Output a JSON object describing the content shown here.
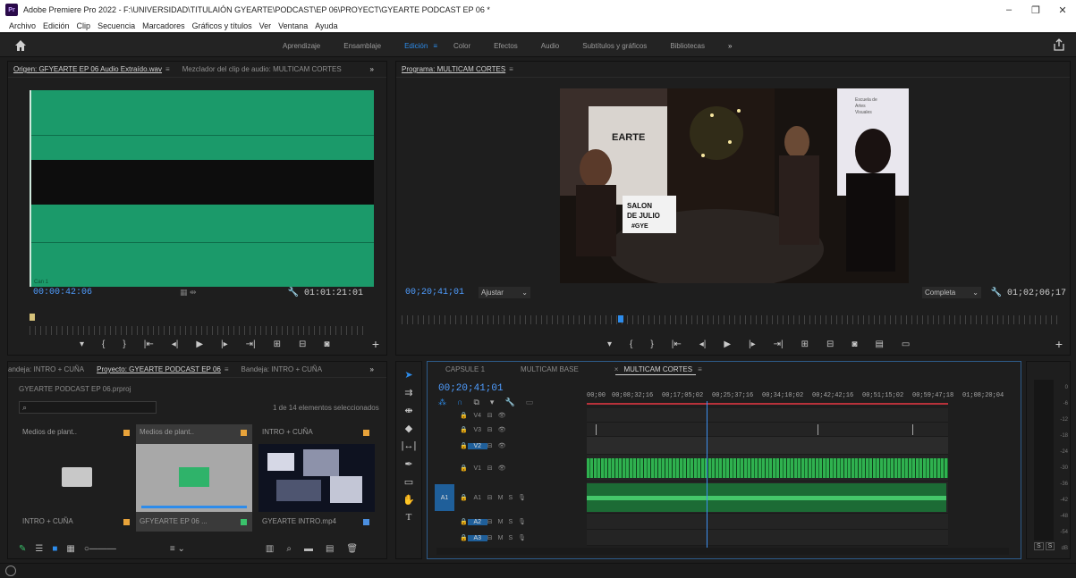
{
  "window": {
    "title": "Adobe Premiere Pro 2022 - F:\\UNIVERSIDAD\\TITULAIÓN GYEARTE\\PODCAST\\EP 06\\PROYECT\\GYEARTE PODCAST EP 06 *",
    "logo_text": "Pr",
    "controls": [
      "–",
      "❐",
      "✕"
    ]
  },
  "menu": [
    "Archivo",
    "Edición",
    "Clip",
    "Secuencia",
    "Marcadores",
    "Gráficos y títulos",
    "Ver",
    "Ventana",
    "Ayuda"
  ],
  "workspaces": {
    "items": [
      "Aprendizaje",
      "Ensamblaje",
      "Edición",
      "Color",
      "Efectos",
      "Audio",
      "Subtítulos y gráficos",
      "Bibliotecas"
    ],
    "active": "Edición",
    "more": "»",
    "menu_glyph": "≡"
  },
  "source": {
    "tab_active": "Origen: GFYEARTE EP 06 Audio Extraído.wav",
    "tab_menu": "≡",
    "tab_other": "Mezclador del clip de audio: MULTICAM CORTES",
    "more": "»",
    "timecode_in": "00:00:42:06",
    "timecode_duration": "01:01:21:01",
    "channel_label": "Can 1"
  },
  "program": {
    "tab": "Programa: MULTICAM CORTES",
    "tab_menu": "≡",
    "timecode": "00;20;41;01",
    "fit": "Ajustar",
    "quality": "Completa",
    "duration": "01;02;06;17",
    "sign_text": "SALON DE JULIO #GYE"
  },
  "project": {
    "tabs": [
      "andeja: INTRO + CUÑA",
      "Proyecto: GYEARTE PODCAST EP 06",
      "Bandeja: INTRO + CUÑA"
    ],
    "tab_menu": "≡",
    "more": "»",
    "file": "GYEARTE PODCAST EP 06.prproj",
    "count": "1 de 14 elementos seleccionados",
    "items": [
      {
        "header": "Medios de plant..",
        "label": "INTRO + CUÑA",
        "swatch": "#e8a33a"
      },
      {
        "header": "Medios de plant..",
        "label": "GFYEARTE EP 06 ...",
        "swatch": "#3ac26b"
      },
      {
        "header": "INTRO + CUÑA",
        "label": "GYEARTE INTRO.mp4",
        "swatch": "#4b8fe0"
      }
    ]
  },
  "timeline": {
    "tabs": [
      "CAPSULE 1",
      "MULTICAM BASE",
      "MULTICAM CORTES"
    ],
    "tab_close": "×",
    "tab_menu": "≡",
    "active": "MULTICAM CORTES",
    "timecode": "00;20;41;01",
    "ruler": [
      "00;00",
      "00;08;32;16",
      "00;17;05;02",
      "00;25;37;16",
      "00;34;10;02",
      "00;42;42;16",
      "00;51;15;02",
      "00;59;47;18",
      "01;08;20;04"
    ],
    "tracks": [
      "V4",
      "V3",
      "V2",
      "V1",
      "A1",
      "A2",
      "A3"
    ],
    "source_patch": "A1",
    "audio_toggles": [
      "M",
      "S"
    ]
  },
  "meter": {
    "scale": [
      "0",
      "-6",
      "-12",
      "-18",
      "-24",
      "-30",
      "-36",
      "-42",
      "-48",
      "-54",
      "dB"
    ],
    "solo_labels": [
      "S",
      "S"
    ]
  },
  "colors": {
    "accent": "#2d8ceb",
    "waveform": "#1b9a6a",
    "video_clip": "#2fb14f"
  }
}
